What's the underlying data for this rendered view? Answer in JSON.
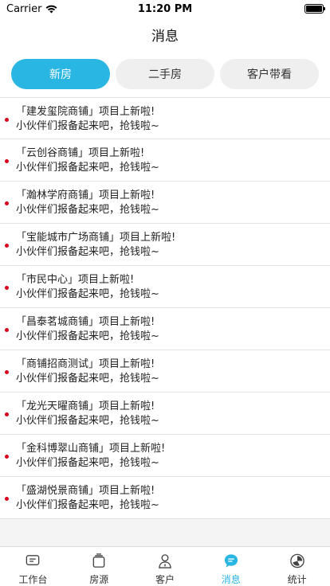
{
  "status_bar": {
    "carrier": "Carrier",
    "time": "11:20 PM"
  },
  "nav": {
    "title": "消息"
  },
  "tabs": [
    {
      "label": "新房",
      "active": true
    },
    {
      "label": "二手房",
      "active": false
    },
    {
      "label": "客户带看",
      "active": false
    }
  ],
  "messages": [
    {
      "title": "「建发玺院商铺」项目上新啦!",
      "body": "小伙伴们报备起来吧，抢钱啦~",
      "unread": true
    },
    {
      "title": "「云创谷商铺」项目上新啦!",
      "body": "小伙伴们报备起来吧，抢钱啦~",
      "unread": true
    },
    {
      "title": "「瀚林学府商铺」项目上新啦!",
      "body": "小伙伴们报备起来吧，抢钱啦~",
      "unread": true
    },
    {
      "title": "「宝能城市广场商铺」项目上新啦!",
      "body": "小伙伴们报备起来吧，抢钱啦~",
      "unread": true
    },
    {
      "title": "「市民中心」项目上新啦!",
      "body": "小伙伴们报备起来吧，抢钱啦~",
      "unread": true
    },
    {
      "title": "「昌泰茗城商铺」项目上新啦!",
      "body": "小伙伴们报备起来吧，抢钱啦~",
      "unread": true
    },
    {
      "title": "「商铺招商测试」项目上新啦!",
      "body": "小伙伴们报备起来吧，抢钱啦~",
      "unread": true
    },
    {
      "title": "「龙光天曜商铺」项目上新啦!",
      "body": "小伙伴们报备起来吧，抢钱啦~",
      "unread": true
    },
    {
      "title": "「金科博翠山商铺」项目上新啦!",
      "body": "小伙伴们报备起来吧，抢钱啦~",
      "unread": true
    },
    {
      "title": "「盛湖悦景商铺」项目上新啦!",
      "body": "小伙伴们报备起来吧，抢钱啦~",
      "unread": true
    }
  ],
  "tab_bar": [
    {
      "label": "工作台",
      "icon": "workbench-icon",
      "active": false
    },
    {
      "label": "房源",
      "icon": "listings-icon",
      "active": false
    },
    {
      "label": "客户",
      "icon": "customer-icon",
      "active": false
    },
    {
      "label": "消息",
      "icon": "message-icon",
      "active": true
    },
    {
      "label": "统计",
      "icon": "statistics-icon",
      "active": false
    }
  ],
  "colors": {
    "accent": "#29b6e3",
    "unread_dot": "#d8001c"
  }
}
